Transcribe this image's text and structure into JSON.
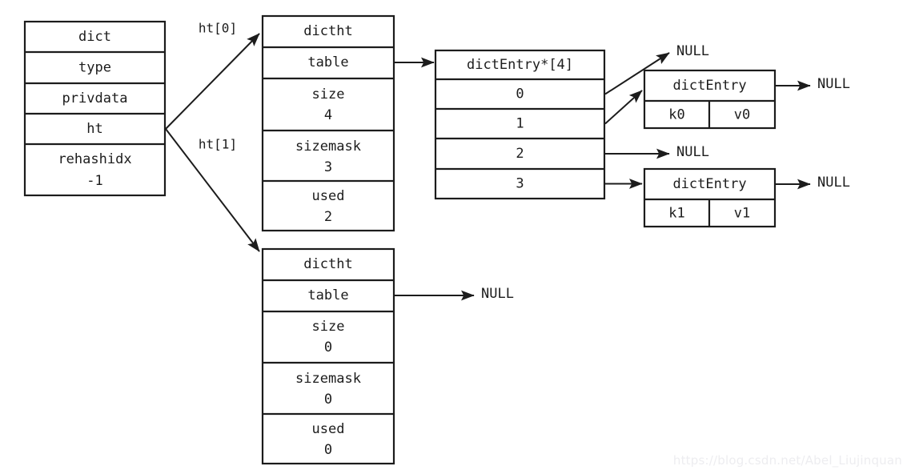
{
  "diagram": {
    "title": "redis-dict-rehash-structure",
    "watermark": "https://blog.csdn.net/Abel_Liujinquan",
    "colors": {
      "stroke": "#1c1c1c",
      "fill": "#ffffff",
      "background": "#ffffff",
      "watermark": "#ededf0"
    },
    "dict": {
      "header": "dict",
      "fields": [
        {
          "name": "type",
          "value": ""
        },
        {
          "name": "privdata",
          "value": ""
        },
        {
          "name": "ht",
          "value": ""
        },
        {
          "name": "rehashidx",
          "value": "-1"
        }
      ]
    },
    "pointer_labels": {
      "ht0": "ht[0]",
      "ht1": "ht[1]"
    },
    "ht0": {
      "header": "dictht",
      "fields": [
        {
          "name": "table",
          "value": ""
        },
        {
          "name": "size",
          "value": "4"
        },
        {
          "name": "sizemask",
          "value": "3"
        },
        {
          "name": "used",
          "value": "2"
        }
      ]
    },
    "ht1": {
      "header": "dictht",
      "fields": [
        {
          "name": "table",
          "value": ""
        },
        {
          "name": "size",
          "value": "0"
        },
        {
          "name": "sizemask",
          "value": "0"
        },
        {
          "name": "used",
          "value": "0"
        }
      ],
      "table_target": "NULL"
    },
    "bucket_array": {
      "header": "dictEntry*[4]",
      "slots": [
        {
          "index": "0",
          "target": "NULL"
        },
        {
          "index": "1",
          "target": "entry0"
        },
        {
          "index": "2",
          "target": "NULL"
        },
        {
          "index": "3",
          "target": "entry1"
        }
      ]
    },
    "entries": [
      {
        "header": "dictEntry",
        "key": "k0",
        "value": "v0",
        "next": "NULL"
      },
      {
        "header": "dictEntry",
        "key": "k1",
        "value": "v1",
        "next": "NULL"
      }
    ],
    "null_labels": {
      "slot0": "NULL",
      "slot2": "NULL",
      "entry0_next": "NULL",
      "entry1_next": "NULL",
      "ht1_table": "NULL"
    }
  }
}
